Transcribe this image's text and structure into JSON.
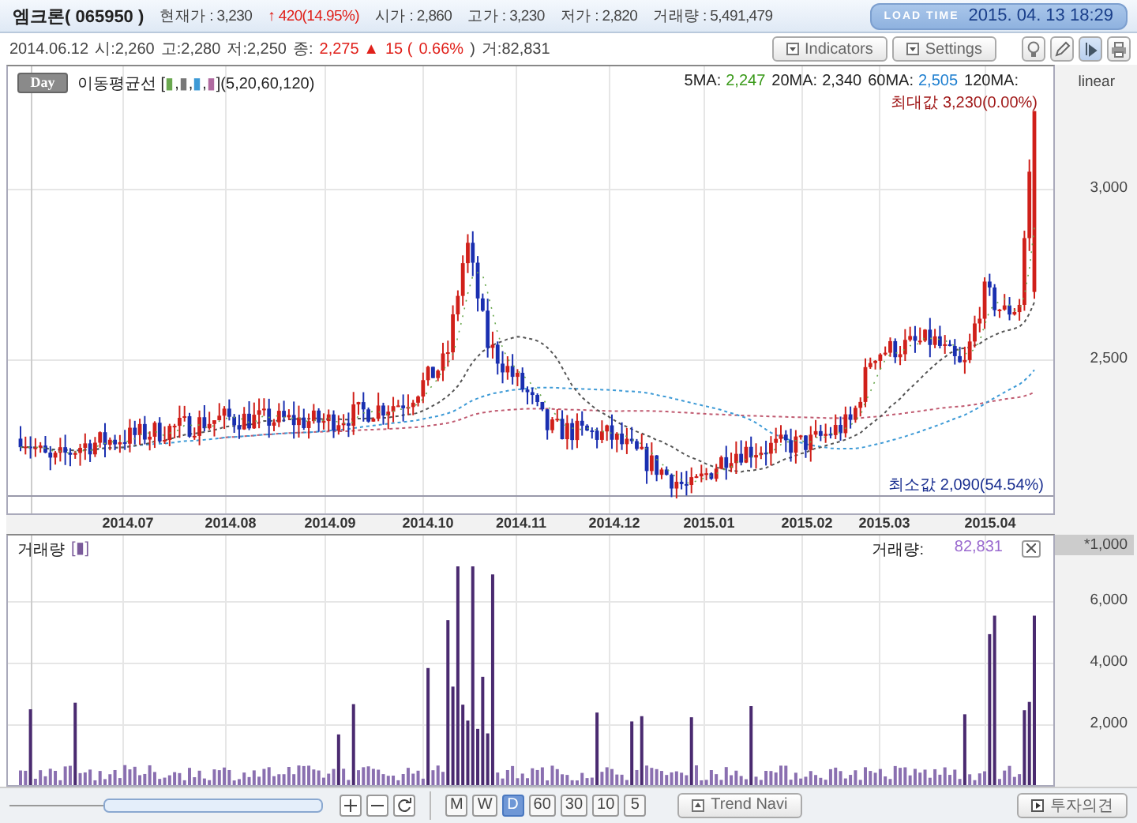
{
  "header": {
    "stock_name": "엠크론( 065950 )",
    "fields": [
      {
        "kind": "plain",
        "text": "현재가 : 3,230"
      },
      {
        "kind": "up",
        "text": "↑ 420(14.95%)"
      },
      {
        "kind": "plain",
        "text": "시가 : 2,860"
      },
      {
        "kind": "plain",
        "text": "고가 : 3,230"
      },
      {
        "kind": "plain",
        "text": "저가 : 2,820"
      },
      {
        "kind": "plain",
        "text": "거래량 : 5,491,479"
      }
    ],
    "load_time": {
      "label": "LOAD TIME",
      "value": "2015. 04. 13 18:29"
    }
  },
  "info": [
    {
      "kind": "plain",
      "text": "2014.06.12"
    },
    {
      "kind": "plain",
      "text": "시:2,260"
    },
    {
      "kind": "plain",
      "text": "고:2,280"
    },
    {
      "kind": "plain",
      "text": "저:2,250"
    },
    {
      "kind": "plain",
      "text": "종:"
    },
    {
      "kind": "up",
      "text": "2,275 ▲"
    },
    {
      "kind": "up",
      "text": "15 ("
    },
    {
      "kind": "up",
      "text": "0.66%"
    },
    {
      "kind": "plain",
      "text": ")"
    },
    {
      "kind": "plain",
      "text": "거:82,831"
    }
  ],
  "buttons": [
    {
      "label": "Indicators"
    },
    {
      "label": "Settings"
    }
  ],
  "tools": [
    {
      "kind": "bulb",
      "selected": false
    },
    {
      "kind": "pen",
      "selected": false
    },
    {
      "kind": "cursor",
      "selected": true
    },
    {
      "kind": "print",
      "selected": false
    }
  ],
  "price_chart": {
    "period_button": "Day",
    "legend_name": "이동평균선",
    "legend": [
      {
        "text": "["
      },
      {
        "text": "▮",
        "color": "#6aa84f"
      },
      {
        "text": ","
      },
      {
        "text": "▮",
        "color": "#777777"
      },
      {
        "text": ","
      },
      {
        "text": "▮",
        "color": "#3d9ad6"
      },
      {
        "text": ","
      },
      {
        "text": "▮",
        "color": "#b06aa0"
      },
      {
        "text": "](5,20,60,120)"
      }
    ],
    "ma": [
      {
        "label": "5MA:",
        "value": "2,247",
        "color": "#3a9a1a"
      },
      {
        "label": "20MA:",
        "value": "2,340",
        "color": "#222222"
      },
      {
        "label": "60MA:",
        "value": "2,505",
        "color": "#1e7fd0"
      },
      {
        "label": "120MA:"
      }
    ],
    "max_label": "최대값 3,230(0.00%)",
    "min_label": "최소값 2,090(54.54%)",
    "scale": "linear",
    "yticks": [
      "3,000",
      "2,500"
    ]
  },
  "x_labels": [
    "2014.07",
    "2014.08",
    "2014.09",
    "2014.10",
    "2014.11",
    "2014.12",
    "2015.01",
    "2015.02",
    "2015.03",
    "2015.04"
  ],
  "volume": {
    "title": "거래량",
    "legend": "[▮]",
    "reading_label": "거래량:",
    "reading": "82,831",
    "unit": "*1,000",
    "yticks": [
      "6,000",
      "4,000",
      "2,000"
    ]
  },
  "bottom_bar": {
    "periods": [
      {
        "label": "M",
        "selected": false
      },
      {
        "label": "W",
        "selected": false
      },
      {
        "label": "D",
        "selected": true
      },
      {
        "label": "60",
        "selected": false
      },
      {
        "label": "30",
        "selected": false
      },
      {
        "label": "10",
        "selected": false
      },
      {
        "label": "5",
        "selected": false
      }
    ],
    "trend_button": "Trend Navi",
    "opinion_button": "투자의견"
  }
}
